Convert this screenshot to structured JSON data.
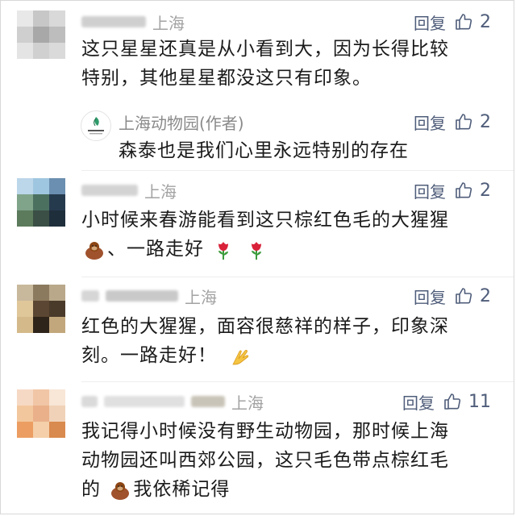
{
  "comments": [
    {
      "location": "上海",
      "reply_label": "回复",
      "likes": "2",
      "text_lines": [
        "这只星星还真是从小看到大，因为长得比较",
        "特别，其他星星都没这只有印象。"
      ],
      "avatar_colors": [
        "#e8e8e8",
        "#c7c7c7",
        "#d9d9d9",
        "#cfcfcf",
        "#a8a8a8",
        "#bdbdbd",
        "#e4e4e4",
        "#d0d0d0",
        "#dadada"
      ]
    },
    {
      "author": "上海动物园(作者)",
      "reply_label": "回复",
      "likes": "2",
      "text_lines": [
        "森泰也是我们心里永远特别的存在"
      ],
      "logo_text": "上海动物园"
    },
    {
      "location": "上海",
      "reply_label": "回复",
      "likes": "2",
      "text_lines": [
        "小时候来春游能看到这只棕红色毛的大猩猩",
        "、一路走好"
      ],
      "avatar_colors": [
        "#bcd6ea",
        "#9fc6e0",
        "#6a8fb0",
        "#7fa48a",
        "#4c7060",
        "#263a4e",
        "#5c7a5c",
        "#3b4f46",
        "#1f2e3b"
      ]
    },
    {
      "location": "上海",
      "reply_label": "回复",
      "likes": "2",
      "text_lines": [
        "红色的大猩猩，面容很慈祥的样子，印象深",
        "刻。一路走好！"
      ],
      "avatar_colors": [
        "#c8b89c",
        "#8c7a5e",
        "#b9a88a",
        "#e0c79a",
        "#5a4632",
        "#4a3a2a",
        "#d4b98a",
        "#2f241a",
        "#c2a77c"
      ]
    },
    {
      "location": "上海",
      "reply_label": "回复",
      "likes": "11",
      "text_lines": [
        "我记得小时候没有野生动物园，那时候上海",
        "动物园还叫西郊公园，这只毛色带点棕红毛",
        "的我依稀记得"
      ],
      "avatar_colors": [
        "#f6d9c4",
        "#f1c6a6",
        "#f8e6d6",
        "#f3c79d",
        "#e9b08a",
        "#f0d2b8",
        "#ec9e62",
        "#f4cfa9",
        "#d98a4e"
      ]
    }
  ],
  "colors": {
    "reply": "#4f5d7a",
    "muted": "#a3a3a3",
    "text": "#1b1b1b",
    "rose": "#d9223a",
    "leaf": "#3c9b3c"
  },
  "icons": [
    "thumbs-up-icon",
    "gorilla-emoji",
    "rose-emoji",
    "pray-emoji"
  ]
}
